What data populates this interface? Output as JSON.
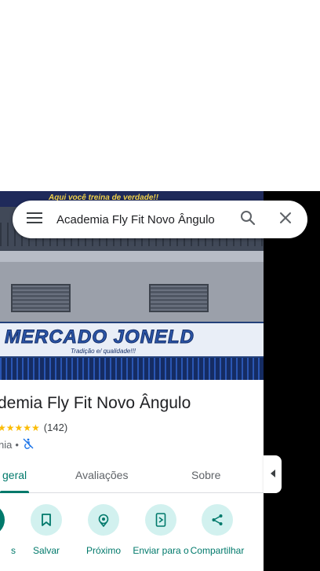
{
  "search": {
    "query": "Academia Fly Fit Novo Ângulo",
    "icons": {
      "menu": "hamburger-menu-icon",
      "search": "search-icon",
      "close": "close-icon"
    }
  },
  "hero": {
    "top_banner_text": "Aqui você treina de verdade!!",
    "sign_text": "MERCADO JONELD",
    "sign_subtext": "Tradição e/ qualidade!!!"
  },
  "place": {
    "title": "demia Fly Fit Novo Ângulo",
    "stars": "★★★★★",
    "rating_count": "(142)",
    "category": "nia",
    "separator": "•",
    "accessibility_icon": "not-accessible-icon"
  },
  "tabs": [
    {
      "label": "geral",
      "active": true
    },
    {
      "label": "Avaliações",
      "active": false
    },
    {
      "label": "Sobre",
      "active": false
    }
  ],
  "actions": [
    {
      "label": "s",
      "icon": "directions-icon"
    },
    {
      "label": "Salvar",
      "icon": "bookmark-icon"
    },
    {
      "label": "Próximo",
      "icon": "nearby-icon"
    },
    {
      "label": "Enviar para o",
      "icon": "send-to-phone-icon"
    },
    {
      "label": "Compartilhar",
      "icon": "share-icon"
    }
  ],
  "colors": {
    "accent": "#00796b",
    "action_bg": "#d2f1ef",
    "star": "#fbbc04"
  }
}
